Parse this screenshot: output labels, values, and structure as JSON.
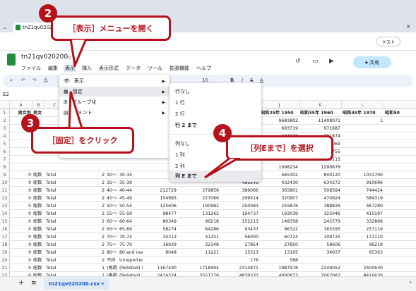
{
  "browser": {
    "tab_title": "tn21qv020200",
    "guest_label": "ゲスト"
  },
  "sheet": {
    "title": "tn21qv020200",
    "menus": [
      "ファイル",
      "編集",
      "表示",
      "挿入",
      "表示形式",
      "データ",
      "ツール",
      "拡張機能",
      "ヘルプ"
    ],
    "active_menu": "表示",
    "share_label": "共有",
    "name_box": "E2",
    "font_size": "10",
    "sheet_tab": "tn21qv020200.csv"
  },
  "grid": {
    "col_headers": [
      "A",
      "B",
      "C",
      "D",
      "E",
      "F",
      "G",
      "H",
      "I",
      "J",
      "K",
      "L"
    ],
    "header_row": [
      "男女別",
      "男女",
      "",
      "",
      "",
      "",
      "",
      "",
      "昭和15年 1940",
      "昭和25年 1950",
      "昭和35年 1960",
      "昭和45年 1970",
      "昭和50"
    ],
    "rows": [
      {
        "n": "2",
        "vals": [
          "",
          "",
          "",
          "",
          "",
          "",
          "",
          "7346983",
          "6277500",
          "9683802",
          "11408071",
          "1"
        ]
      },
      {
        "n": "3",
        "vals": [
          "",
          "",
          "",
          "",
          "",
          "",
          "",
          "843200",
          "780018",
          "693719",
          "971687",
          ""
        ]
      },
      {
        "n": "4",
        "vals": [
          "",
          "",
          "",
          "",
          "",
          "",
          "",
          "",
          "",
          "674170",
          "791874",
          ""
        ]
      },
      {
        "n": "5",
        "vals": [
          "",
          "",
          "",
          "",
          "",
          "",
          "",
          "",
          "",
          "881163",
          "637069",
          ""
        ]
      },
      {
        "n": "6",
        "vals": [
          "",
          "",
          "",
          "",
          "",
          "",
          "",
          "",
          "",
          "1250356",
          "963755",
          ""
        ]
      },
      {
        "n": "7",
        "vals": [
          "",
          "",
          "",
          "",
          "",
          "",
          "",
          "",
          "",
          "1301446",
          "1675115",
          ""
        ]
      },
      {
        "n": "8",
        "vals": [
          "",
          "",
          "",
          "",
          "",
          "",
          "",
          "",
          "",
          "1098234",
          "1290878",
          ""
        ]
      },
      {
        "n": "9",
        "vals": [
          "0",
          "総数",
          "Total",
          "2",
          "30～34",
          "30-34",
          "",
          "",
          "588173",
          "465302",
          "840120",
          "1031700",
          ""
        ]
      },
      {
        "n": "10",
        "vals": [
          "0",
          "総数",
          "Total",
          "2",
          "35～39",
          "35-39",
          "",
          "",
          "489243",
          "432430",
          "634272",
          "910696",
          ""
        ]
      },
      {
        "n": "11",
        "vals": [
          "0",
          "総数",
          "Total",
          "2",
          "40～44",
          "40-44",
          "212729",
          "279856",
          "386066",
          "365801",
          "508584",
          "744424",
          ""
        ]
      },
      {
        "n": "12",
        "vals": [
          "0",
          "総数",
          "Total",
          "2",
          "45～49",
          "45-49",
          "154983",
          "227066",
          "299514",
          "320907",
          "470924",
          "584319",
          ""
        ]
      },
      {
        "n": "13",
        "vals": [
          "0",
          "総数",
          "Total",
          "2",
          "50～54",
          "50-54",
          "125606",
          "190982",
          "250083",
          "255876",
          "388826",
          "467280",
          ""
        ]
      },
      {
        "n": "14",
        "vals": [
          "0",
          "総数",
          "Total",
          "2",
          "55～59",
          "55-59",
          "98477",
          "131262",
          "194737",
          "193039",
          "325046",
          "415597",
          ""
        ]
      },
      {
        "n": "15",
        "vals": [
          "0",
          "総数",
          "Total",
          "2",
          "60～64",
          "60-64",
          "80349",
          "96218",
          "152213",
          "148358",
          "242579",
          "332866",
          ""
        ]
      },
      {
        "n": "16",
        "vals": [
          "0",
          "総数",
          "Total",
          "2",
          "65～69",
          "65-69",
          "58274",
          "64286",
          "93437",
          "96322",
          "165295",
          "257119",
          ""
        ]
      },
      {
        "n": "17",
        "vals": [
          "0",
          "総数",
          "Total",
          "2",
          "70～74",
          "70-74",
          "34313",
          "41251",
          "56000",
          "60724",
          "109725",
          "172110",
          ""
        ]
      },
      {
        "n": "18",
        "vals": [
          "0",
          "総数",
          "Total",
          "2",
          "75～79",
          "75-79",
          "16929",
          "22148",
          "27854",
          "27850",
          "58606",
          "96219",
          ""
        ]
      },
      {
        "n": "19",
        "vals": [
          "0",
          "総数",
          "Total",
          "2",
          "80～",
          "80 and over",
          "8048",
          "11221",
          "15313",
          "13165",
          "34037",
          "65363",
          ""
        ]
      },
      {
        "n": "20",
        "vals": [
          "0",
          "総数",
          "Total",
          "2",
          "不詳",
          "Unreported",
          "",
          "",
          "176",
          "588",
          "",
          ""
        ]
      },
      {
        "n": "21",
        "vals": [
          "0",
          "総数",
          "Total",
          "1",
          "(再掲)0～14",
          "(Relisted) 0-14",
          "1167490",
          "1718494",
          "2314871",
          "1987978",
          "2249052",
          "2400630",
          ""
        ]
      },
      {
        "n": "22",
        "vals": [
          "0",
          "総数",
          "Total",
          "1",
          "(再掲)15～64",
          "(Relisted) 15-64",
          "2414374",
          "3551278",
          "4839332",
          "4090873",
          "7067087",
          "8416630",
          ""
        ]
      }
    ]
  },
  "view_menu": {
    "items": [
      {
        "icon": "eye-icon",
        "label": "表示",
        "arrow": true
      },
      {
        "icon": "freeze-icon",
        "label": "固定",
        "arrow": true
      },
      {
        "icon": "group-icon",
        "label": "グループ化",
        "arrow": true
      },
      {
        "icon": "comment-icon",
        "label": "コメント",
        "arrow": true
      }
    ]
  },
  "freeze_menu": {
    "items": [
      "行なし",
      "1 行",
      "2 行",
      "行 2 まで",
      "列なし",
      "1 列",
      "2 列",
      "列 E まで"
    ]
  },
  "callouts": {
    "c2": "［表示］メニューを開く",
    "c3": "［固定］をクリック",
    "c4": "［列Eまで］を選択",
    "n2": "2",
    "n3": "3",
    "n4": "4"
  },
  "colors": {
    "accent": "#b5121b",
    "sheets_green": "#1e8e3e",
    "share_bg": "#c2e7ff"
  }
}
